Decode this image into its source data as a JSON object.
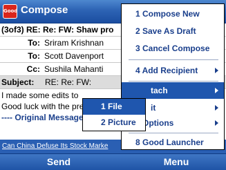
{
  "app": {
    "logo_text": "Good",
    "title": "Compose"
  },
  "email": {
    "subject_header": "(3of3) RE: Re: FW: Shaw pro",
    "to_label": "To:",
    "to_1": "Sriram Krishnan",
    "to_2": "Scott Davenport",
    "cc_label": "Cc:",
    "cc_value": "Sushila Mahanti",
    "subject_label": "Subject:",
    "subject_value": "RE: Re: FW:",
    "body_line_1": "I made some edits to",
    "body_line_2": "Good luck with the presentat",
    "original_message": "---- Original Message ----",
    "footer_link": "Can China Defuse Its Stock Marke"
  },
  "softkeys": {
    "left": "Send",
    "right": "Menu"
  },
  "menu": {
    "items": [
      "1 Compose New",
      "2 Save As Draft",
      "3 Cancel Compose",
      "4 Add Recipient",
      "tach",
      "it",
      "7 Options",
      "8 Good Launcher"
    ]
  },
  "submenu": {
    "items": [
      "1 File",
      "2 Picture"
    ]
  },
  "colors": {
    "accent": "#1f56ae",
    "menu_text": "#1a3f8c",
    "logo": "#d9251c"
  }
}
